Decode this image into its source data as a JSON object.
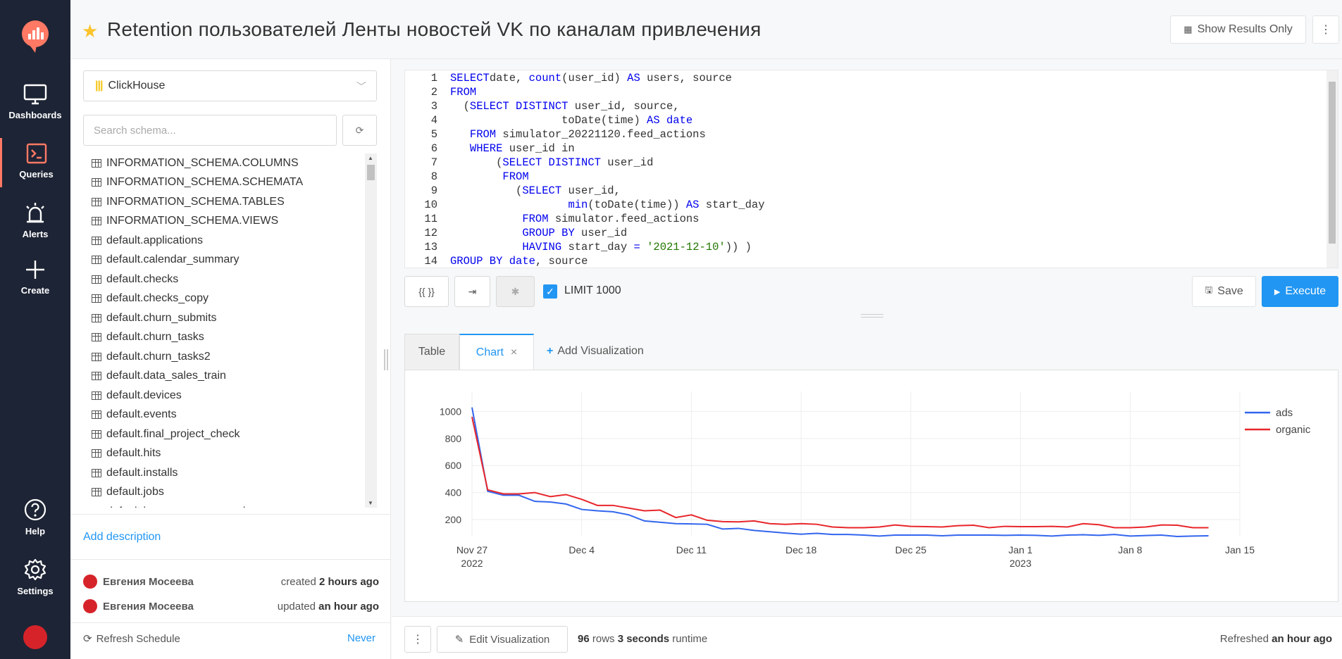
{
  "nav": {
    "items": [
      {
        "label": "Dashboards",
        "icon": "monitor-icon"
      },
      {
        "label": "Queries",
        "icon": "terminal-icon"
      },
      {
        "label": "Alerts",
        "icon": "alarm-icon"
      },
      {
        "label": "Create",
        "icon": "plus-icon"
      }
    ],
    "bottom": [
      {
        "label": "Help",
        "icon": "question-icon"
      },
      {
        "label": "Settings",
        "icon": "gear-icon"
      }
    ]
  },
  "header": {
    "title": "Retention пользователей Ленты новостей VK по каналам привлечения",
    "show_results_label": "Show Results Only",
    "kebab_label": "⋮"
  },
  "schema": {
    "datasource": "ClickHouse",
    "search_placeholder": "Search schema...",
    "tables": [
      "INFORMATION_SCHEMA.COLUMNS",
      "INFORMATION_SCHEMA.SCHEMATA",
      "INFORMATION_SCHEMA.TABLES",
      "INFORMATION_SCHEMA.VIEWS",
      "default.applications",
      "default.calendar_summary",
      "default.checks",
      "default.checks_copy",
      "default.churn_submits",
      "default.churn_tasks",
      "default.churn_tasks2",
      "default.data_sales_train",
      "default.devices",
      "default.events",
      "default.final_project_check",
      "default.hits",
      "default.installs",
      "default.jobs",
      "default.karpov_express_orders"
    ]
  },
  "description": {
    "add_label": "Add description"
  },
  "meta": {
    "created_by": "Евгения Мосеева",
    "created_prefix": "created",
    "created_when": "2 hours ago",
    "updated_by": "Евгения Мосеева",
    "updated_prefix": "updated",
    "updated_when": "an hour ago",
    "refresh_label": "Refresh Schedule",
    "refresh_value": "Never"
  },
  "editor": {
    "lines": [
      "1",
      "2",
      "3",
      "4",
      "5",
      "6",
      "7",
      "8",
      "9",
      "10",
      "11",
      "12",
      "13",
      "14"
    ]
  },
  "toolbar": {
    "params_label": "{{ }}",
    "limit_label": "LIMIT 1000",
    "save_label": "Save",
    "execute_label": "Execute"
  },
  "viz": {
    "tabs": [
      "Table",
      "Chart"
    ],
    "close_label": "×",
    "add_label": "Add Visualization"
  },
  "footer": {
    "edit_label": "Edit Visualization",
    "rows_count": "96",
    "rows_label": "rows",
    "runtime_value": "3 seconds",
    "runtime_label": "runtime",
    "refreshed_label": "Refreshed",
    "refreshed_when": "an hour ago"
  },
  "colors": {
    "accent": "#2196f3",
    "nav_bg": "#1d2435",
    "ads": "#3366ee",
    "organic": "#e8262b"
  },
  "chart_data": {
    "type": "line",
    "x_ticks": [
      "Nov 27",
      "Dec 4",
      "Dec 11",
      "Dec 18",
      "Dec 25",
      "Jan 1",
      "Jan 8",
      "Jan 15"
    ],
    "x_tick_years": [
      "2022",
      "",
      "",
      "",
      "",
      "2023",
      "",
      ""
    ],
    "y_ticks": [
      200,
      400,
      600,
      800,
      1000
    ],
    "x_range": [
      "2022-11-27",
      "2023-01-15"
    ],
    "ylim": [
      80,
      1070
    ],
    "legend_position": "top-right",
    "grid": true,
    "series": [
      {
        "name": "ads",
        "color": "#3366ee",
        "x": [
          "2022-11-27",
          "2022-11-28",
          "2022-11-29",
          "2022-11-30",
          "2022-12-01",
          "2022-12-02",
          "2022-12-03",
          "2022-12-04",
          "2022-12-05",
          "2022-12-06",
          "2022-12-07",
          "2022-12-08",
          "2022-12-09",
          "2022-12-10",
          "2022-12-11",
          "2022-12-12",
          "2022-12-13",
          "2022-12-14",
          "2022-12-15",
          "2022-12-16",
          "2022-12-17",
          "2022-12-18",
          "2022-12-19",
          "2022-12-20",
          "2022-12-21",
          "2022-12-22",
          "2022-12-23",
          "2022-12-24",
          "2022-12-25",
          "2022-12-26",
          "2022-12-27",
          "2022-12-28",
          "2022-12-29",
          "2022-12-30",
          "2022-12-31",
          "2023-01-01",
          "2023-01-02",
          "2023-01-03",
          "2023-01-04",
          "2023-01-05",
          "2023-01-06",
          "2023-01-07",
          "2023-01-08",
          "2023-01-09",
          "2023-01-10",
          "2023-01-11",
          "2023-01-12",
          "2023-01-13"
        ],
        "values": [
          1030,
          410,
          380,
          380,
          335,
          330,
          315,
          275,
          265,
          258,
          235,
          190,
          180,
          170,
          168,
          165,
          130,
          135,
          120,
          110,
          100,
          92,
          98,
          90,
          90,
          85,
          78,
          85,
          85,
          85,
          80,
          85,
          85,
          85,
          83,
          85,
          83,
          78,
          85,
          88,
          83,
          90,
          78,
          82,
          85,
          75,
          78,
          80
        ]
      },
      {
        "name": "organic",
        "color": "#e8262b",
        "x": [
          "2022-11-27",
          "2022-11-28",
          "2022-11-29",
          "2022-11-30",
          "2022-12-01",
          "2022-12-02",
          "2022-12-03",
          "2022-12-04",
          "2022-12-05",
          "2022-12-06",
          "2022-12-07",
          "2022-12-08",
          "2022-12-09",
          "2022-12-10",
          "2022-12-11",
          "2022-12-12",
          "2022-12-13",
          "2022-12-14",
          "2022-12-15",
          "2022-12-16",
          "2022-12-17",
          "2022-12-18",
          "2022-12-19",
          "2022-12-20",
          "2022-12-21",
          "2022-12-22",
          "2022-12-23",
          "2022-12-24",
          "2022-12-25",
          "2022-12-26",
          "2022-12-27",
          "2022-12-28",
          "2022-12-29",
          "2022-12-30",
          "2022-12-31",
          "2023-01-01",
          "2023-01-02",
          "2023-01-03",
          "2023-01-04",
          "2023-01-05",
          "2023-01-06",
          "2023-01-07",
          "2023-01-08",
          "2023-01-09",
          "2023-01-10",
          "2023-01-11",
          "2023-01-12",
          "2023-01-13"
        ],
        "values": [
          960,
          420,
          390,
          390,
          400,
          370,
          385,
          350,
          305,
          305,
          285,
          265,
          270,
          215,
          235,
          195,
          185,
          183,
          190,
          170,
          165,
          170,
          165,
          145,
          140,
          140,
          145,
          160,
          150,
          148,
          145,
          155,
          158,
          140,
          150,
          148,
          148,
          150,
          145,
          170,
          162,
          140,
          140,
          145,
          160,
          158,
          140,
          140
        ]
      }
    ]
  }
}
